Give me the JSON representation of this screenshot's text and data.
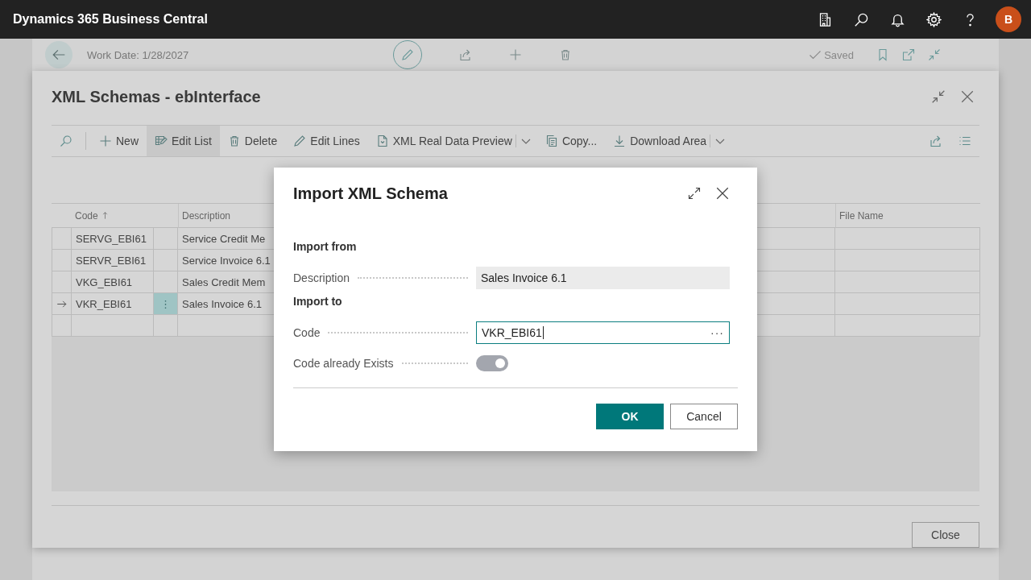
{
  "app_bar": {
    "title": "Dynamics 365 Business Central",
    "avatar": "B"
  },
  "back_page": {
    "work_date": "Work Date: 1/28/2027",
    "status": "Saved"
  },
  "page": {
    "title": "XML Schemas - ebInterface",
    "actions": [
      {
        "label": "New",
        "selected": false,
        "dropdown": false
      },
      {
        "label": "Edit List",
        "selected": true,
        "dropdown": false
      },
      {
        "label": "Delete",
        "selected": false,
        "dropdown": false
      },
      {
        "label": "Edit Lines",
        "selected": false,
        "dropdown": false
      },
      {
        "label": "XML Real Data Preview",
        "selected": false,
        "dropdown": true
      },
      {
        "label": "Copy...",
        "selected": false,
        "dropdown": false
      },
      {
        "label": "Download Area",
        "selected": false,
        "dropdown": true
      }
    ],
    "table": {
      "row_menu": "⋮",
      "columns": [
        {
          "label": "Code",
          "sorted": true
        },
        {
          "label": "Description",
          "sorted": false
        },
        {
          "label": "File Name",
          "sorted": false
        }
      ],
      "rows": [
        {
          "code": "SERVG_EBI61",
          "description": "Service Credit Me",
          "current": false
        },
        {
          "code": "SERVR_EBI61",
          "description": "Service Invoice 6.1",
          "current": false
        },
        {
          "code": "VKG_EBI61",
          "description": "Sales Credit Mem",
          "current": false
        },
        {
          "code": "VKR_EBI61",
          "description": "Sales Invoice 6.1",
          "current": true
        }
      ]
    },
    "close_button": "Close"
  },
  "dialog": {
    "title": "Import XML Schema",
    "sections": [
      {
        "heading": "Import from",
        "fields": [
          {
            "kind": "readonly",
            "label": "Description",
            "value": "Sales Invoice 6.1"
          }
        ]
      },
      {
        "heading": "Import to",
        "fields": [
          {
            "kind": "lookup",
            "label": "Code",
            "value": "VKR_EBI61",
            "lookup": "···"
          },
          {
            "kind": "toggle",
            "label": "Code already Exists",
            "on": true,
            "disabled": true
          }
        ]
      }
    ],
    "buttons": [
      {
        "label": "OK",
        "primary": true
      },
      {
        "label": "Cancel",
        "primary": false
      }
    ]
  }
}
